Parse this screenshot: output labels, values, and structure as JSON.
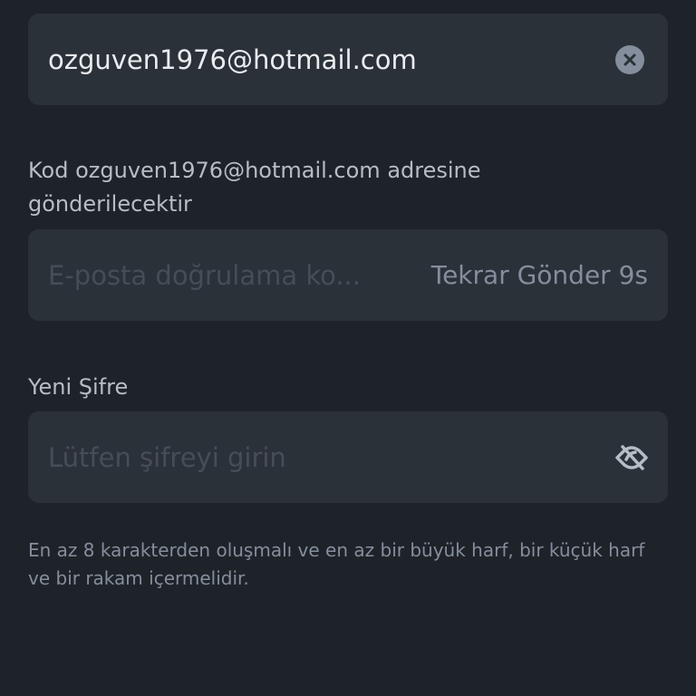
{
  "email_field": {
    "value": "ozguven1976@hotmail.com",
    "clear_icon": "clear-circle-x-icon"
  },
  "code_section": {
    "label": "Kod ozguven1976@hotmail.com adresine gönderilecektir",
    "placeholder": "E-posta doğrulama ko...",
    "resend_label": "Tekrar Gönder 9s"
  },
  "password_section": {
    "label": "Yeni Şifre",
    "placeholder": "Lütfen şifreyi girin",
    "visibility_icon": "eye-off-icon"
  },
  "hint": "En az 8 karakterden oluşmalı ve en az bir büyük harf, bir küçük harf ve bir rakam içermelidir.",
  "colors": {
    "background": "#1e2329",
    "field_background": "#2b3139",
    "text_primary": "#eaecef",
    "text_secondary": "#b7bdc6",
    "text_muted": "#848e9c",
    "placeholder": "#474d57"
  }
}
